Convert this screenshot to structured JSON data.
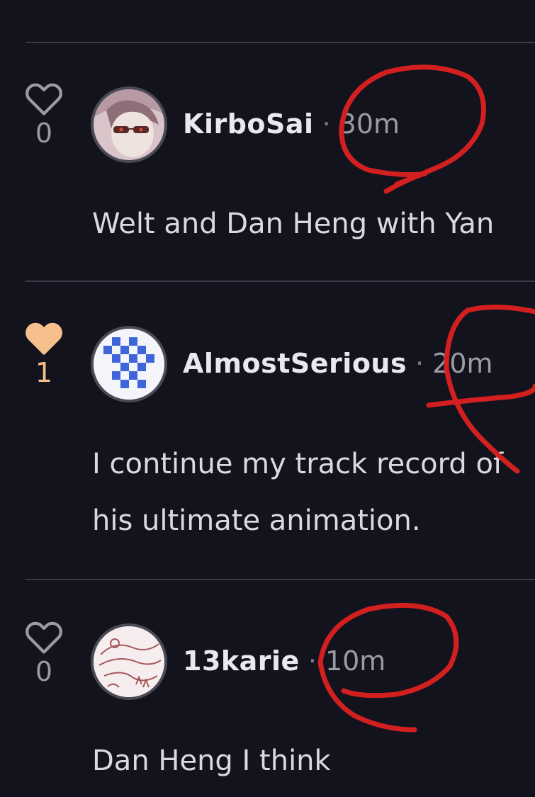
{
  "comments": [
    {
      "username": "KirboSai",
      "separator": "·",
      "time": "30m",
      "likes": "0",
      "liked": false,
      "lines": [
        "Welt and Dan Heng with Yan"
      ]
    },
    {
      "username": "AlmostSerious",
      "separator": "·",
      "time": "20m",
      "likes": "1",
      "liked": true,
      "lines": [
        "I continue my track record of",
        "his ultimate animation."
      ]
    },
    {
      "username": "13karie",
      "separator": "·",
      "time": "10m",
      "likes": "0",
      "liked": false,
      "lines": [
        "Dan Heng I think"
      ]
    }
  ],
  "colors": {
    "background": "#13131d",
    "liked_heart": "#f5c08b",
    "annotation": "#d21f1f"
  },
  "icons": {
    "like": "heart-outline-icon",
    "liked": "heart-filled-icon"
  }
}
